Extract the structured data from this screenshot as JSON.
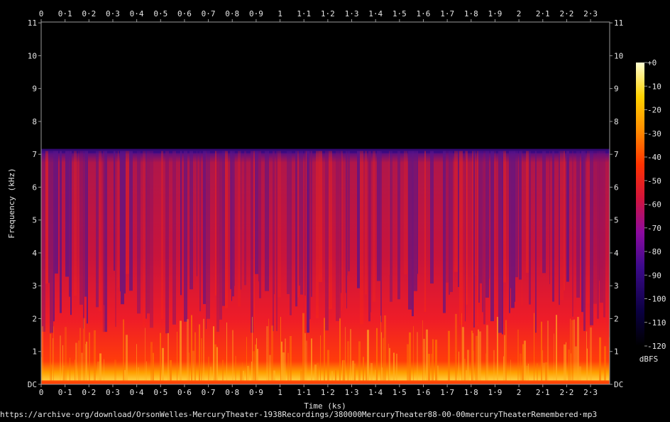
{
  "chart_data": {
    "type": "heatmap",
    "title": "",
    "xlabel": "Time (ks)",
    "ylabel": "Frequency (kHz)",
    "x_ticks": [
      "0",
      "0·1",
      "0·2",
      "0·3",
      "0·4",
      "0·5",
      "0·6",
      "0·7",
      "0·8",
      "0·9",
      "1",
      "1·1",
      "1·2",
      "1·3",
      "1·4",
      "1·5",
      "1·6",
      "1·7",
      "1·8",
      "1·9",
      "2",
      "2·1",
      "2·2",
      "2·3"
    ],
    "xlim": [
      0,
      2.38
    ],
    "y_ticks": [
      "DC",
      "1",
      "2",
      "3",
      "4",
      "5",
      "6",
      "7",
      "8",
      "9",
      "10",
      "11"
    ],
    "ylim": [
      0,
      11.025
    ],
    "colorbar": {
      "label": "dBFS",
      "ticks": [
        "+0",
        "-10",
        "-20",
        "-30",
        "-40",
        "-50",
        "-60",
        "-70",
        "-80",
        "-90",
        "-100",
        "-110",
        "-120"
      ],
      "range": [
        -120,
        0
      ],
      "colors": [
        "#000000",
        "#0a0040",
        "#3c0a8c",
        "#8c0aa0",
        "#d2143c",
        "#ff3200",
        "#ff8c00",
        "#ffd200",
        "#ffffd2"
      ]
    },
    "content_cutoff_khz": 7.1,
    "grid": false
  },
  "footer": {
    "source_url": "https://archive·org/download/OrsonWelles-MercuryTheater-1938Recordings/380000MercuryTheater88-00-00mercuryTheaterRemembered·mp3"
  }
}
